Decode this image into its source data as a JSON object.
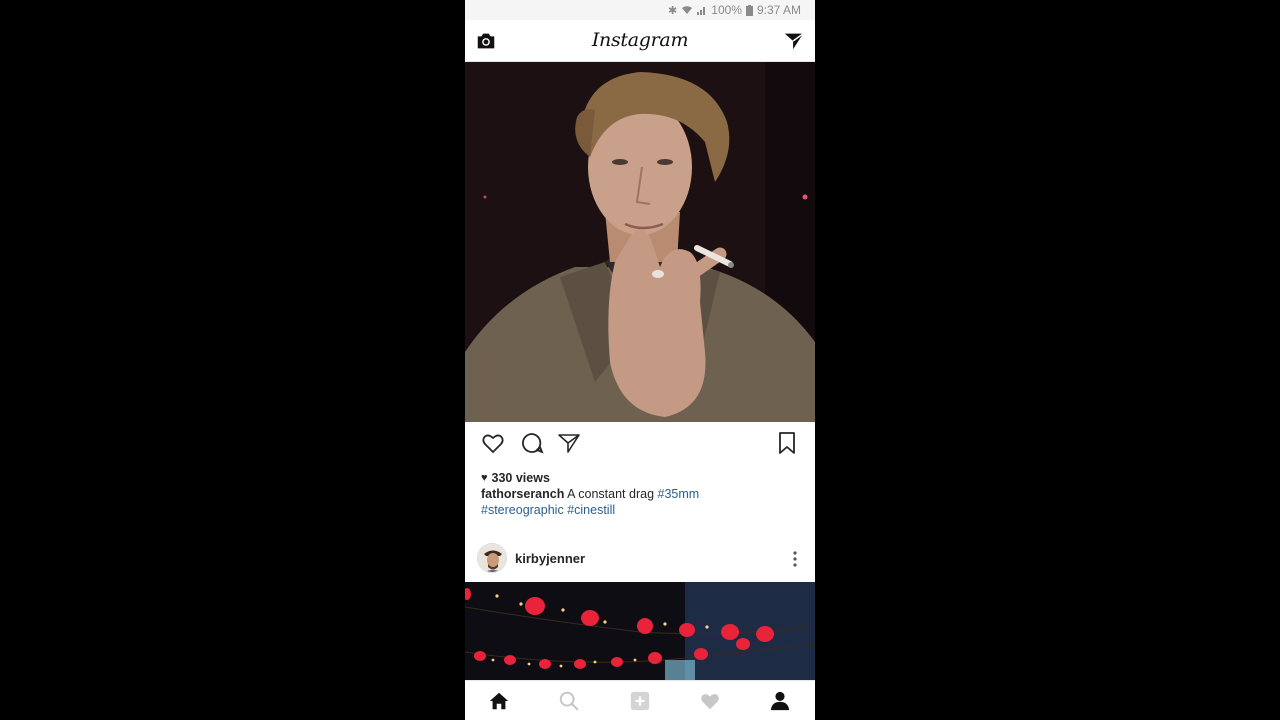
{
  "status_bar": {
    "battery": "100%",
    "time": "9:37 AM"
  },
  "app_bar": {
    "title": "Instagram"
  },
  "post1": {
    "views": "330 views",
    "username": "fathorseranch",
    "caption_text": "A constant drag",
    "hashtags": [
      "#35mm",
      "#stereographic",
      "#cinestill"
    ]
  },
  "post2": {
    "username": "kirbyjenner"
  },
  "icons": {
    "camera": "camera-icon",
    "direct": "direct-message-icon",
    "like": "heart-outline-icon",
    "comment": "comment-icon",
    "share": "share-icon",
    "save": "bookmark-icon",
    "more": "more-vertical-icon",
    "home": "home-icon",
    "search": "search-icon",
    "add": "add-post-icon",
    "activity": "heart-icon",
    "profile": "profile-icon"
  },
  "colors": {
    "hashtag": "#2a5f8f",
    "text": "#262626",
    "inactive_icon": "#c7c7c7"
  }
}
